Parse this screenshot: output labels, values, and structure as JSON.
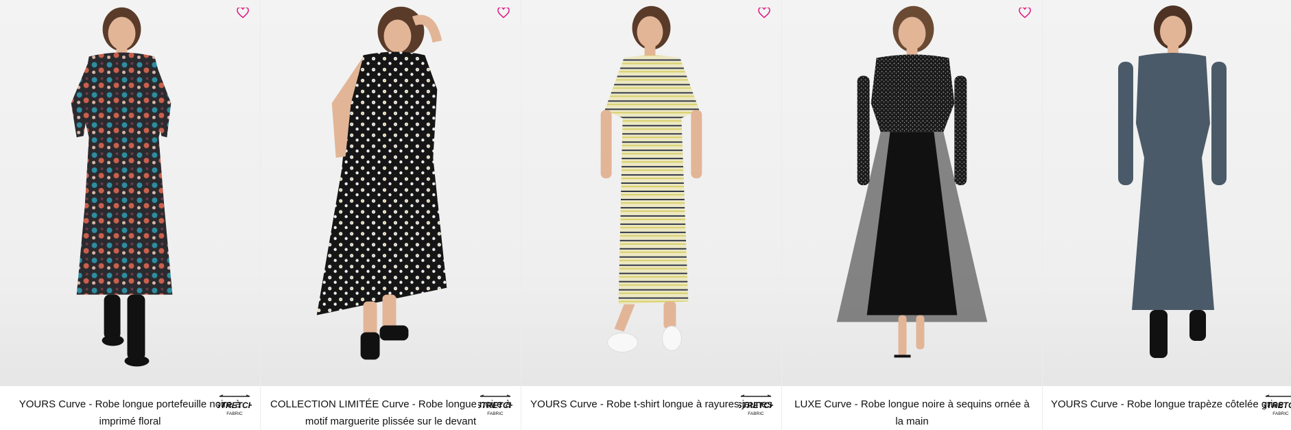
{
  "products": [
    {
      "title": "YOURS Curve - Robe longue portefeuille noire à imprimé floral",
      "badge": "STRETCH FABRIC",
      "dress_color": "#2b2a2e"
    },
    {
      "title": "COLLECTION LIMITÉE Curve - Robe longue noire à motif marguerite plissée sur le devant",
      "badge": "STRETCH FABRIC",
      "dress_color": "#151515"
    },
    {
      "title": "YOURS Curve - Robe t-shirt longue à rayures jaunes",
      "badge": "STRETCH FABRIC",
      "dress_color": "#e8e4b8"
    },
    {
      "title": "LUXE Curve - Robe longue noire à sequins ornée à la main",
      "badge": "STRETCH FABRIC",
      "dress_color": "#141414"
    },
    {
      "title": "YOURS Curve - Robe longue trapèze côtelée grise",
      "badge": "STRETCH FABRIC",
      "dress_color": "#4b5a68"
    }
  ],
  "icons": {
    "wishlist": "heart-outline-icon",
    "fabric_badge": "stretch-fabric-icon"
  },
  "colors": {
    "wishlist_pink": "#e0127e",
    "text": "#111111",
    "background": "#f0f0f0"
  }
}
